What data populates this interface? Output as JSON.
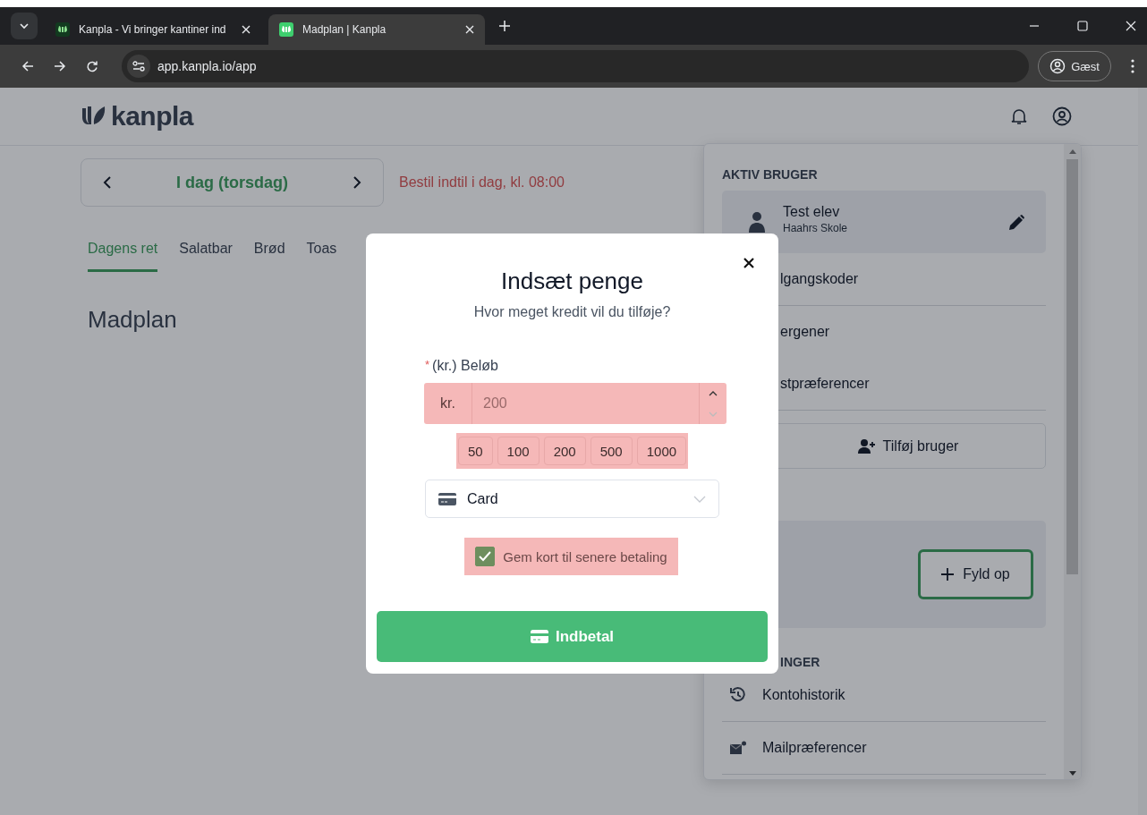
{
  "browser": {
    "tabs": [
      {
        "title": "Kanpla - Vi bringer kantiner ind",
        "selected": false
      },
      {
        "title": "Madplan | Kanpla",
        "selected": true
      }
    ],
    "url": "app.kanpla.io/app",
    "profile": "Gæst"
  },
  "header": {
    "logo": "kanpla"
  },
  "day_nav": {
    "label": "I dag (torsdag)",
    "deadline": "Bestil indtil i dag, kl. 08:00"
  },
  "categories": [
    {
      "label": "Dagens ret",
      "selected": true
    },
    {
      "label": "Salatbar",
      "selected": false
    },
    {
      "label": "Brød",
      "selected": false
    },
    {
      "label": "Toas",
      "selected": false
    }
  ],
  "heading": "Madplan",
  "user_menu": {
    "section_title": "AKTIV BRUGER",
    "user": {
      "name": "Test elev",
      "school": "Haahrs Skole"
    },
    "items": [
      "lgangskoder",
      "ergener",
      "stpræferencer"
    ],
    "add_user": "Tilføj bruger",
    "topup_button": "Fyld op",
    "section2_title": "INGER",
    "items2": [
      {
        "label": "Kontohistorik",
        "kind": "history"
      },
      {
        "label": "Mailpræferencer",
        "kind": "mail"
      }
    ]
  },
  "modal": {
    "title": "Indsæt penge",
    "subtitle": "Hvor meget kredit vil du tilføje?",
    "required_mark": "*",
    "amount_label": "(kr.) Beløb",
    "prefix": "kr.",
    "placeholder": "200",
    "presets": [
      "50",
      "100",
      "200",
      "500",
      "1000"
    ],
    "payment_method": "Card",
    "save_card": {
      "label": "Gem kort til senere betaling",
      "checked": true
    },
    "submit": "Indbetal"
  }
}
